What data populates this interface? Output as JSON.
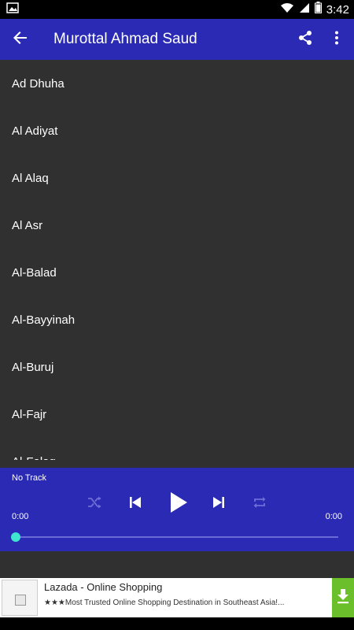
{
  "status_bar": {
    "time": "3:42"
  },
  "app_bar": {
    "title": "Murottal Ahmad Saud"
  },
  "list": {
    "items": [
      "Ad Dhuha",
      "Al Adiyat",
      "Al Alaq",
      "Al Asr",
      "Al-Balad",
      "Al-Bayyinah",
      "Al-Buruj",
      "Al-Fajr",
      "Al-Falaq"
    ]
  },
  "player": {
    "track": "No Track",
    "time_current": "0:00",
    "time_total": "0:00",
    "progress": 0
  },
  "ad": {
    "title": "Lazada - Online Shopping",
    "text": "★★★Most Trusted Online Shopping Destination in Southeast Asia!..."
  },
  "colors": {
    "primary": "#2a2ab4",
    "accent": "#3ee6d0",
    "background": "#303030",
    "download": "#6bbf2a"
  }
}
